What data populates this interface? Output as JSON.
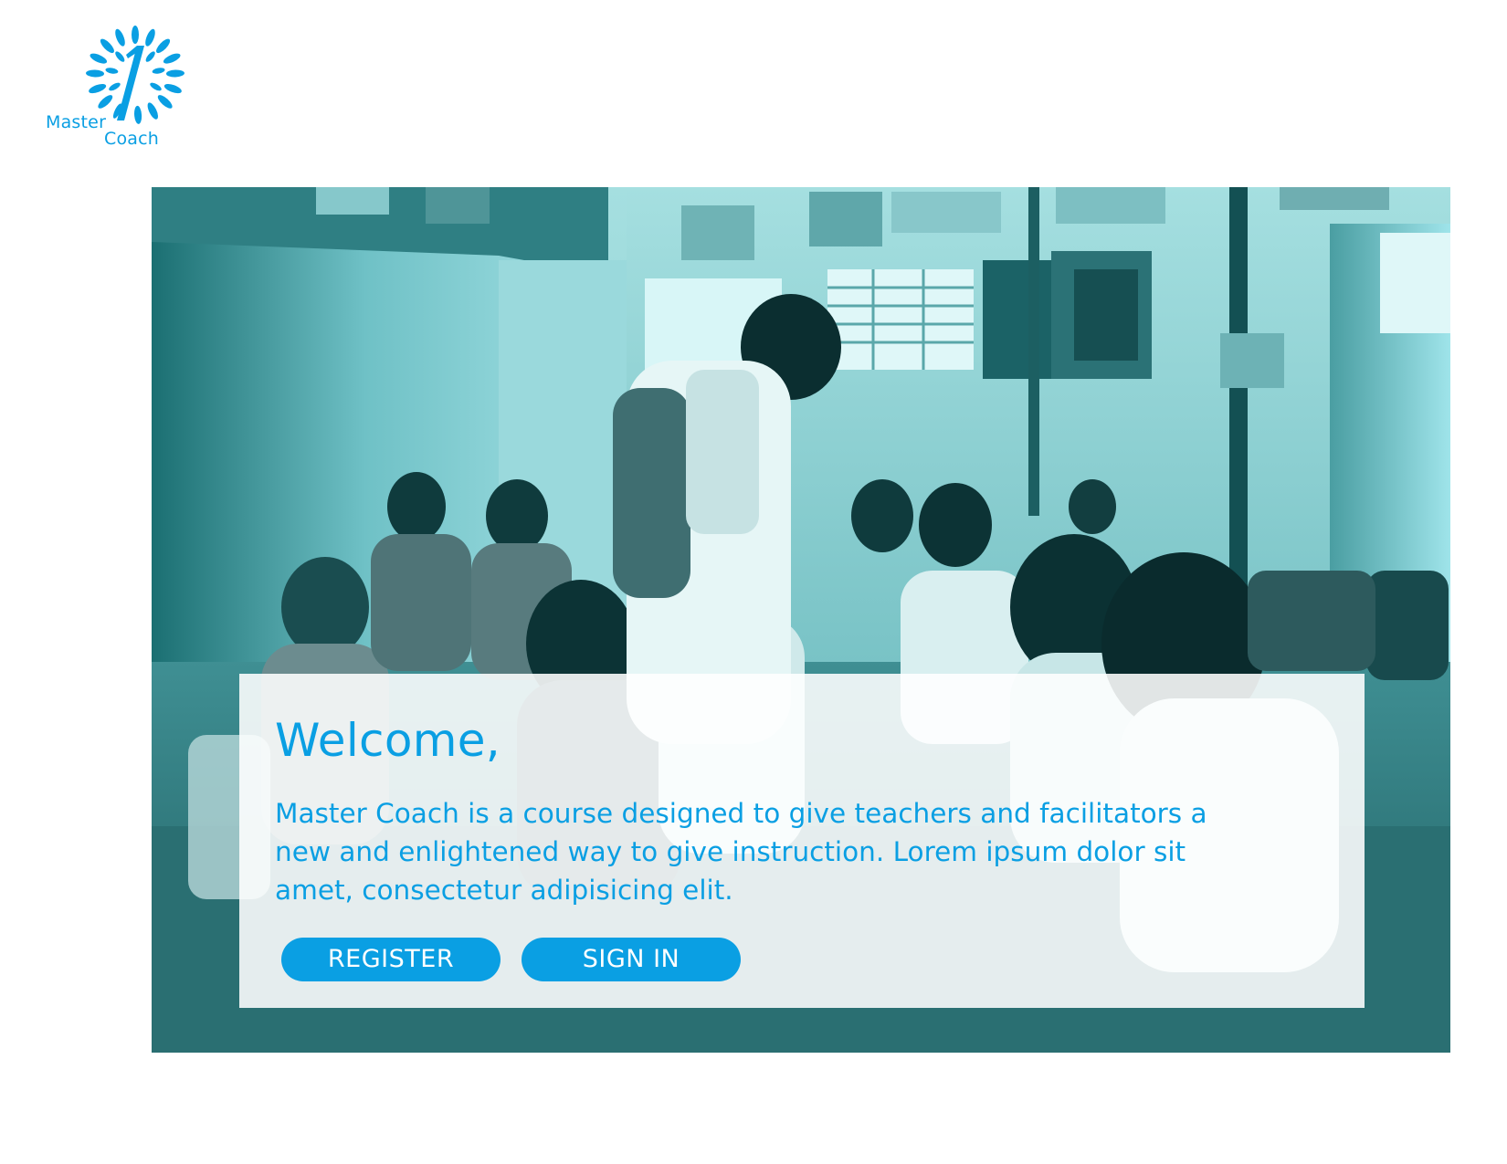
{
  "logo": {
    "line1": "Master",
    "line2": "Coach",
    "icon": "sunburst-one-logo-icon"
  },
  "hero": {
    "image": "classroom-teacher-with-students-photo",
    "tint": "#7cc9cc"
  },
  "welcome": {
    "title": "Welcome,",
    "description": "Master Coach is a course designed to give teachers and facilitators a new and enlightened way to give instruction. Lorem ipsum dolor sit amet, consectetur adipisicing elit."
  },
  "buttons": {
    "register": "REGISTER",
    "sign_in": "SIGN IN"
  },
  "colors": {
    "brand": "#0a9fe3",
    "button_text": "#ffffff"
  }
}
